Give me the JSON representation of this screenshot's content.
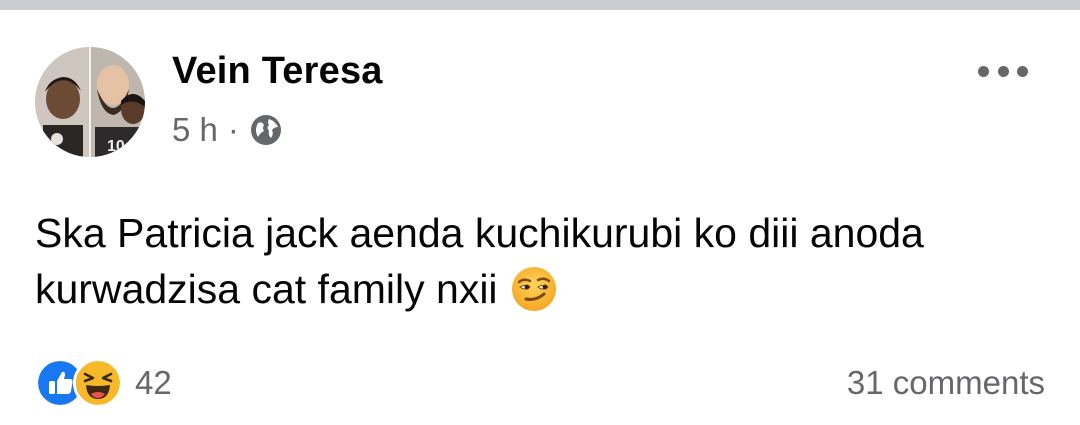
{
  "post": {
    "author": "Vein Teresa",
    "time": "5 h",
    "separator": "·",
    "audience_icon": "globe-icon",
    "more_icon": "more-options-icon",
    "text": "Ska Patricia jack aenda kuchikurubi ko diii anoda kurwadzisa cat family nxii",
    "text_emoji": "smirking-face-emoji",
    "reactions": {
      "icons": [
        "like-reaction-icon",
        "haha-reaction-icon"
      ],
      "count": "42"
    },
    "comments": "31 comments"
  },
  "colors": {
    "top_bar": "#c9ccd1",
    "primary_text": "#050505",
    "secondary_text": "#65676b",
    "like_blue": "#1877f2",
    "emoji_yellow": "#f7b928"
  }
}
